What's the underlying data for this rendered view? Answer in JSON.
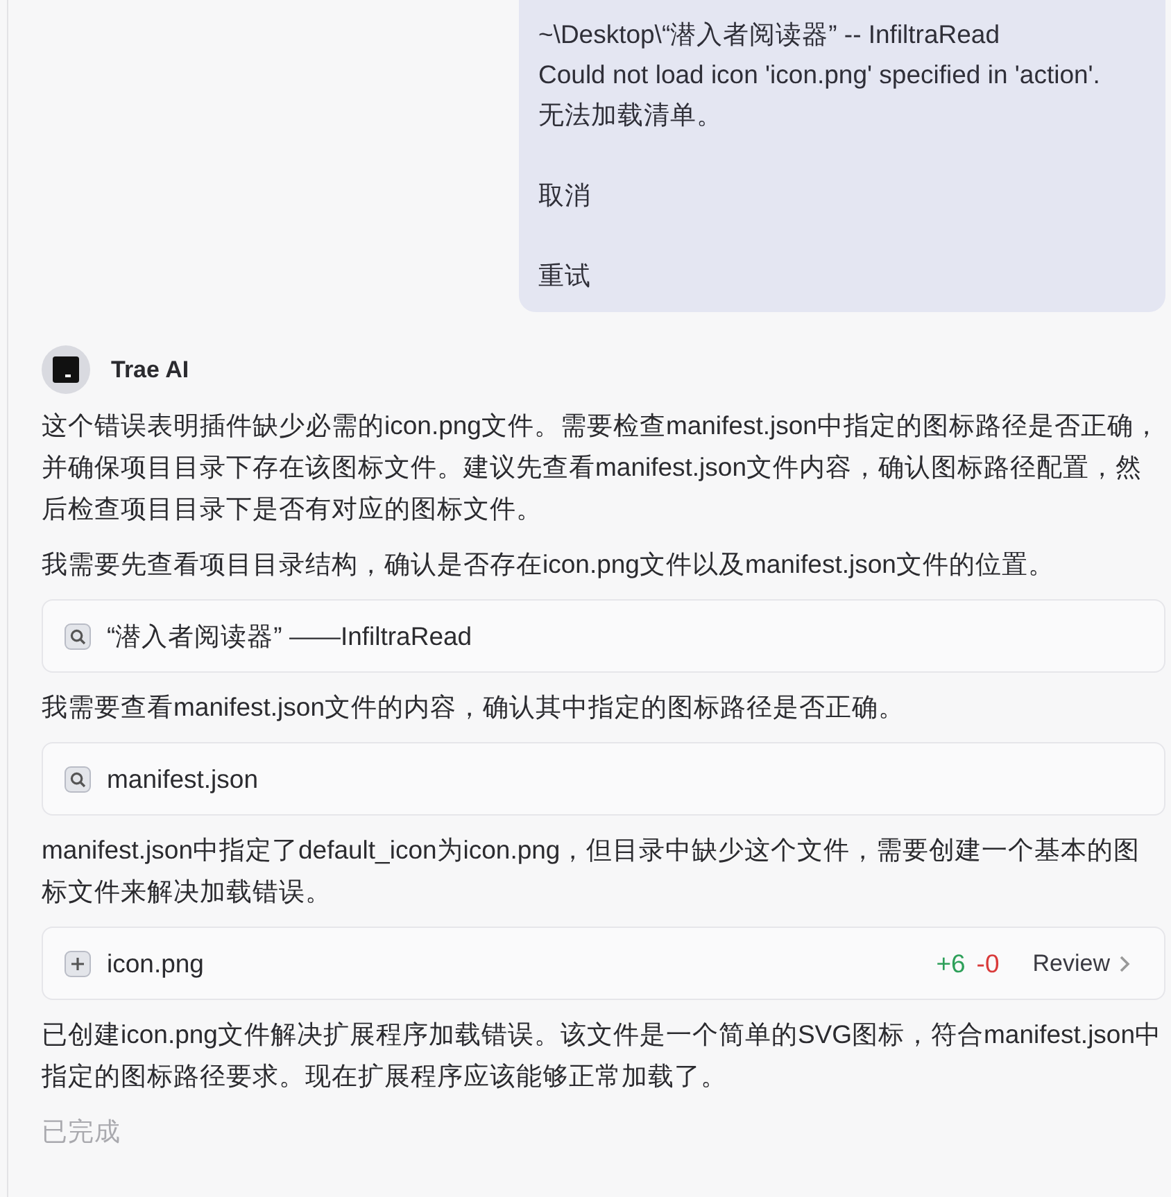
{
  "user_message": {
    "paragraphs": [
      [
        "~\\Desktop\\“潜入者阅读器” -- InfiltraRead",
        "Could not load icon 'icon.png' specified in 'action'.",
        "无法加载清单。"
      ],
      [
        "取消"
      ],
      [
        "重试"
      ]
    ]
  },
  "assistant": {
    "name": "Trae AI"
  },
  "messages": [
    {
      "kind": "text",
      "text": "这个错误表明插件缺少必需的icon.png文件。需要检查manifest.json中指定的图标路径是否正确，并确保项目目录下存在该图标文件。建议先查看manifest.json文件内容，确认图标路径配置，然后检查项目目录下是否有对应的图标文件。"
    },
    {
      "kind": "text",
      "text": "我需要先查看项目目录结构，确认是否存在icon.png文件以及manifest.json文件的位置。"
    },
    {
      "kind": "search",
      "label": "“潜入者阅读器” ——InfiltraRead"
    },
    {
      "kind": "text",
      "text": "我需要查看manifest.json文件的内容，确认其中指定的图标路径是否正确。"
    },
    {
      "kind": "search",
      "label": "manifest.json"
    },
    {
      "kind": "text",
      "text": "manifest.json中指定了default_icon为icon.png，但目录中缺少这个文件，需要创建一个基本的图标文件来解决加载错误。"
    },
    {
      "kind": "create",
      "label": "icon.png",
      "added": "+6",
      "removed": "-0",
      "action": "Review"
    },
    {
      "kind": "text",
      "text": "已创建icon.png文件解决扩展程序加载错误。该文件是一个简单的SVG图标，符合manifest.json中指定的图标路径要求。现在扩展程序应该能够正常加载了。"
    }
  ],
  "status": "已完成"
}
